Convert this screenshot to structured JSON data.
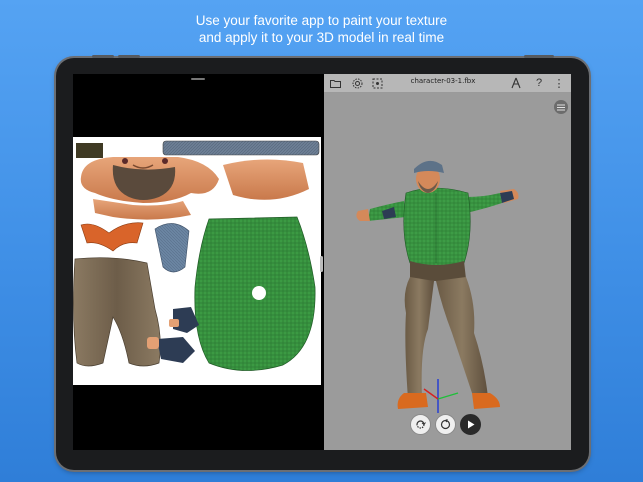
{
  "caption": {
    "line1": "Use your favorite app to paint your texture",
    "line2": "and apply it to your 3D model in real time"
  },
  "viewer": {
    "filename": "character-03-1.fbx",
    "toolbar_icons": [
      "folder-icon",
      "gear-icon",
      "camera-reset-icon",
      "compass-icon",
      "help-icon",
      "more-icon"
    ],
    "help_glyph": "?",
    "more_glyph": "⋮"
  },
  "playback": {
    "buttons": [
      "loop-icon",
      "loop-sync-icon",
      "play-icon"
    ]
  },
  "colors": {
    "background": "#4a97ee",
    "viewport": "#9b9b9b",
    "shirt": "#3b9a43",
    "pants": "#7b6a55",
    "skin": "#d4895a",
    "shoes": "#d96a1f",
    "cap": "#5d7288"
  }
}
